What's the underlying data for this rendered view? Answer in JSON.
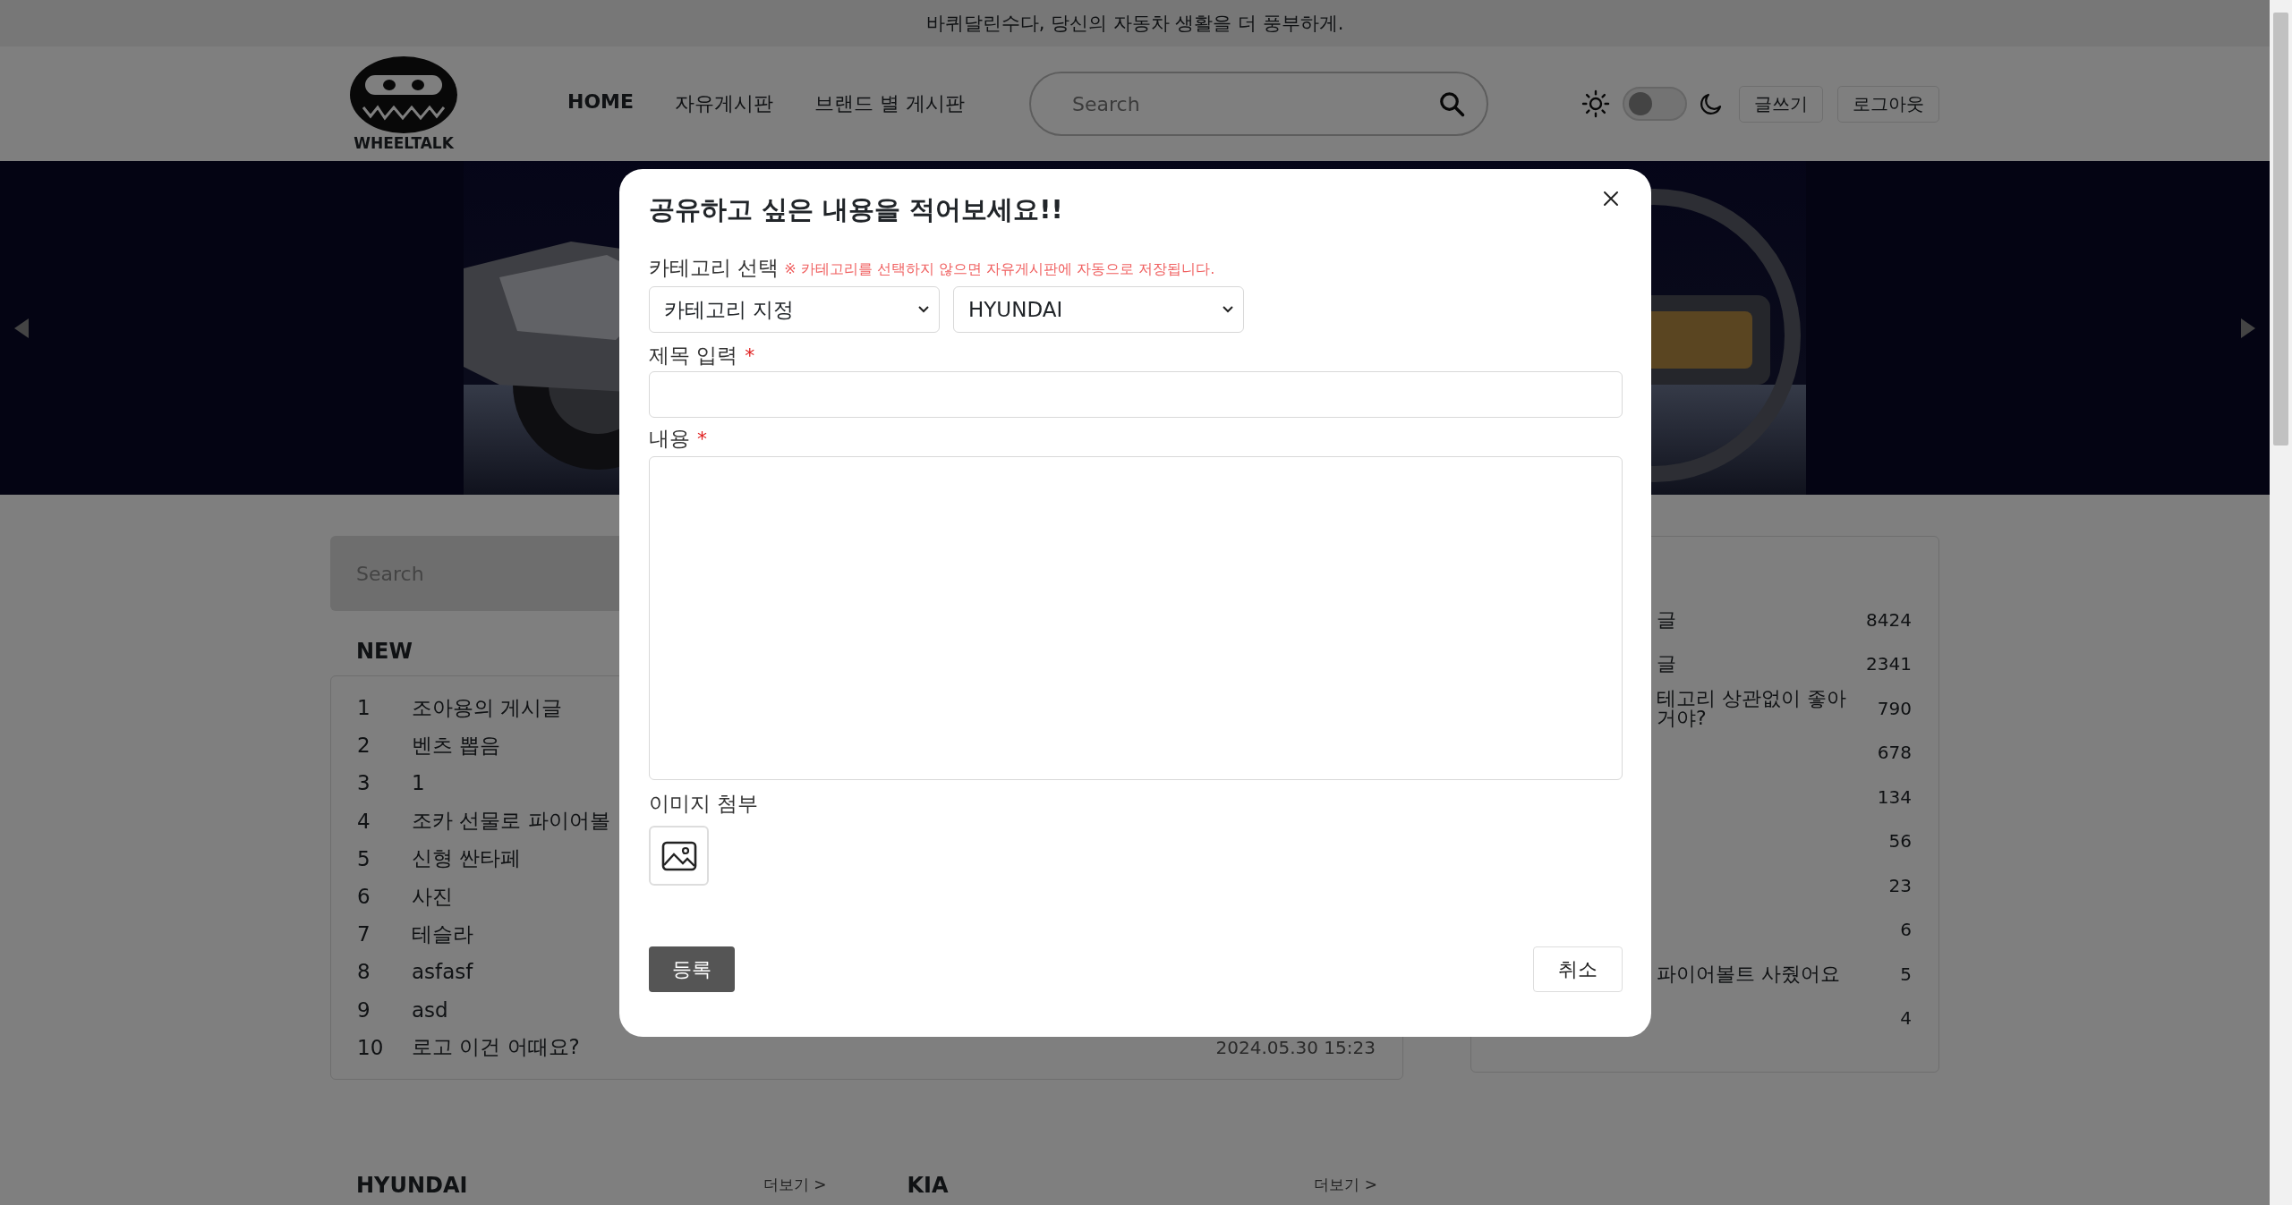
{
  "announcement": "바퀴달린수다, 당신의 자동차 생활을 더 풍부하게.",
  "header": {
    "logo_text": "WHEELTALK",
    "nav": [
      {
        "label": "HOME",
        "selected": true
      },
      {
        "label": "자유게시판",
        "selected": false
      },
      {
        "label": "브랜드 별 게시판",
        "selected": false
      }
    ],
    "search": {
      "placeholder": "Search"
    },
    "theme_toggle": {
      "on": false
    },
    "buttons": [
      "글쓰기",
      "로그아웃"
    ]
  },
  "sidebar_search": {
    "placeholder": "Search"
  },
  "new_posts": {
    "title": "NEW",
    "rows": [
      {
        "rank": "1",
        "title": "조아용의 게시글"
      },
      {
        "rank": "2",
        "title": "벤츠 뽑음"
      },
      {
        "rank": "3",
        "title": "1"
      },
      {
        "rank": "4",
        "title": "조카 선물로 파이어볼"
      },
      {
        "rank": "5",
        "title": "신형 싼타페"
      },
      {
        "rank": "6",
        "title": "사진"
      },
      {
        "rank": "7",
        "title": "테슬라"
      },
      {
        "rank": "8",
        "title": "asfasf"
      },
      {
        "rank": "9",
        "title": "asd"
      },
      {
        "rank": "10",
        "title": "로고 이건 어때요?",
        "date": "2024.05.30 15:23"
      }
    ]
  },
  "popular": {
    "rows": [
      {
        "title": "글",
        "count": "8424"
      },
      {
        "title": "글",
        "count": "2341"
      },
      {
        "title": "테고리 상관없이 좋아\n거야?",
        "count": "790"
      },
      {
        "count": "678"
      },
      {
        "count": "134"
      },
      {
        "count": "56"
      },
      {
        "count": "23"
      },
      {
        "count": "6"
      },
      {
        "title": "파이어볼트 사줬어요",
        "count": "5"
      },
      {
        "count": "4"
      }
    ]
  },
  "brand_sections": [
    {
      "title": "HYUNDAI",
      "more": "더보기 >"
    },
    {
      "title": "KIA",
      "more": "더보기 >"
    }
  ],
  "modal": {
    "title": "공유하고 싶은 내용을 적어보세요!!",
    "category": {
      "label": "카테고리 선택",
      "note": "※ 카테고리를 선택하지 않으면 자유게시판에 자동으로 저장됩니다.",
      "selects": [
        {
          "value": "카테고리 지정"
        },
        {
          "value": "HYUNDAI"
        }
      ]
    },
    "title_field": {
      "label": "제목 입력",
      "required_mark": "*"
    },
    "content_field": {
      "label": "내용",
      "required_mark": "*"
    },
    "attachment": {
      "label": "이미지 첨부"
    },
    "submit": "등록",
    "cancel": "취소"
  }
}
